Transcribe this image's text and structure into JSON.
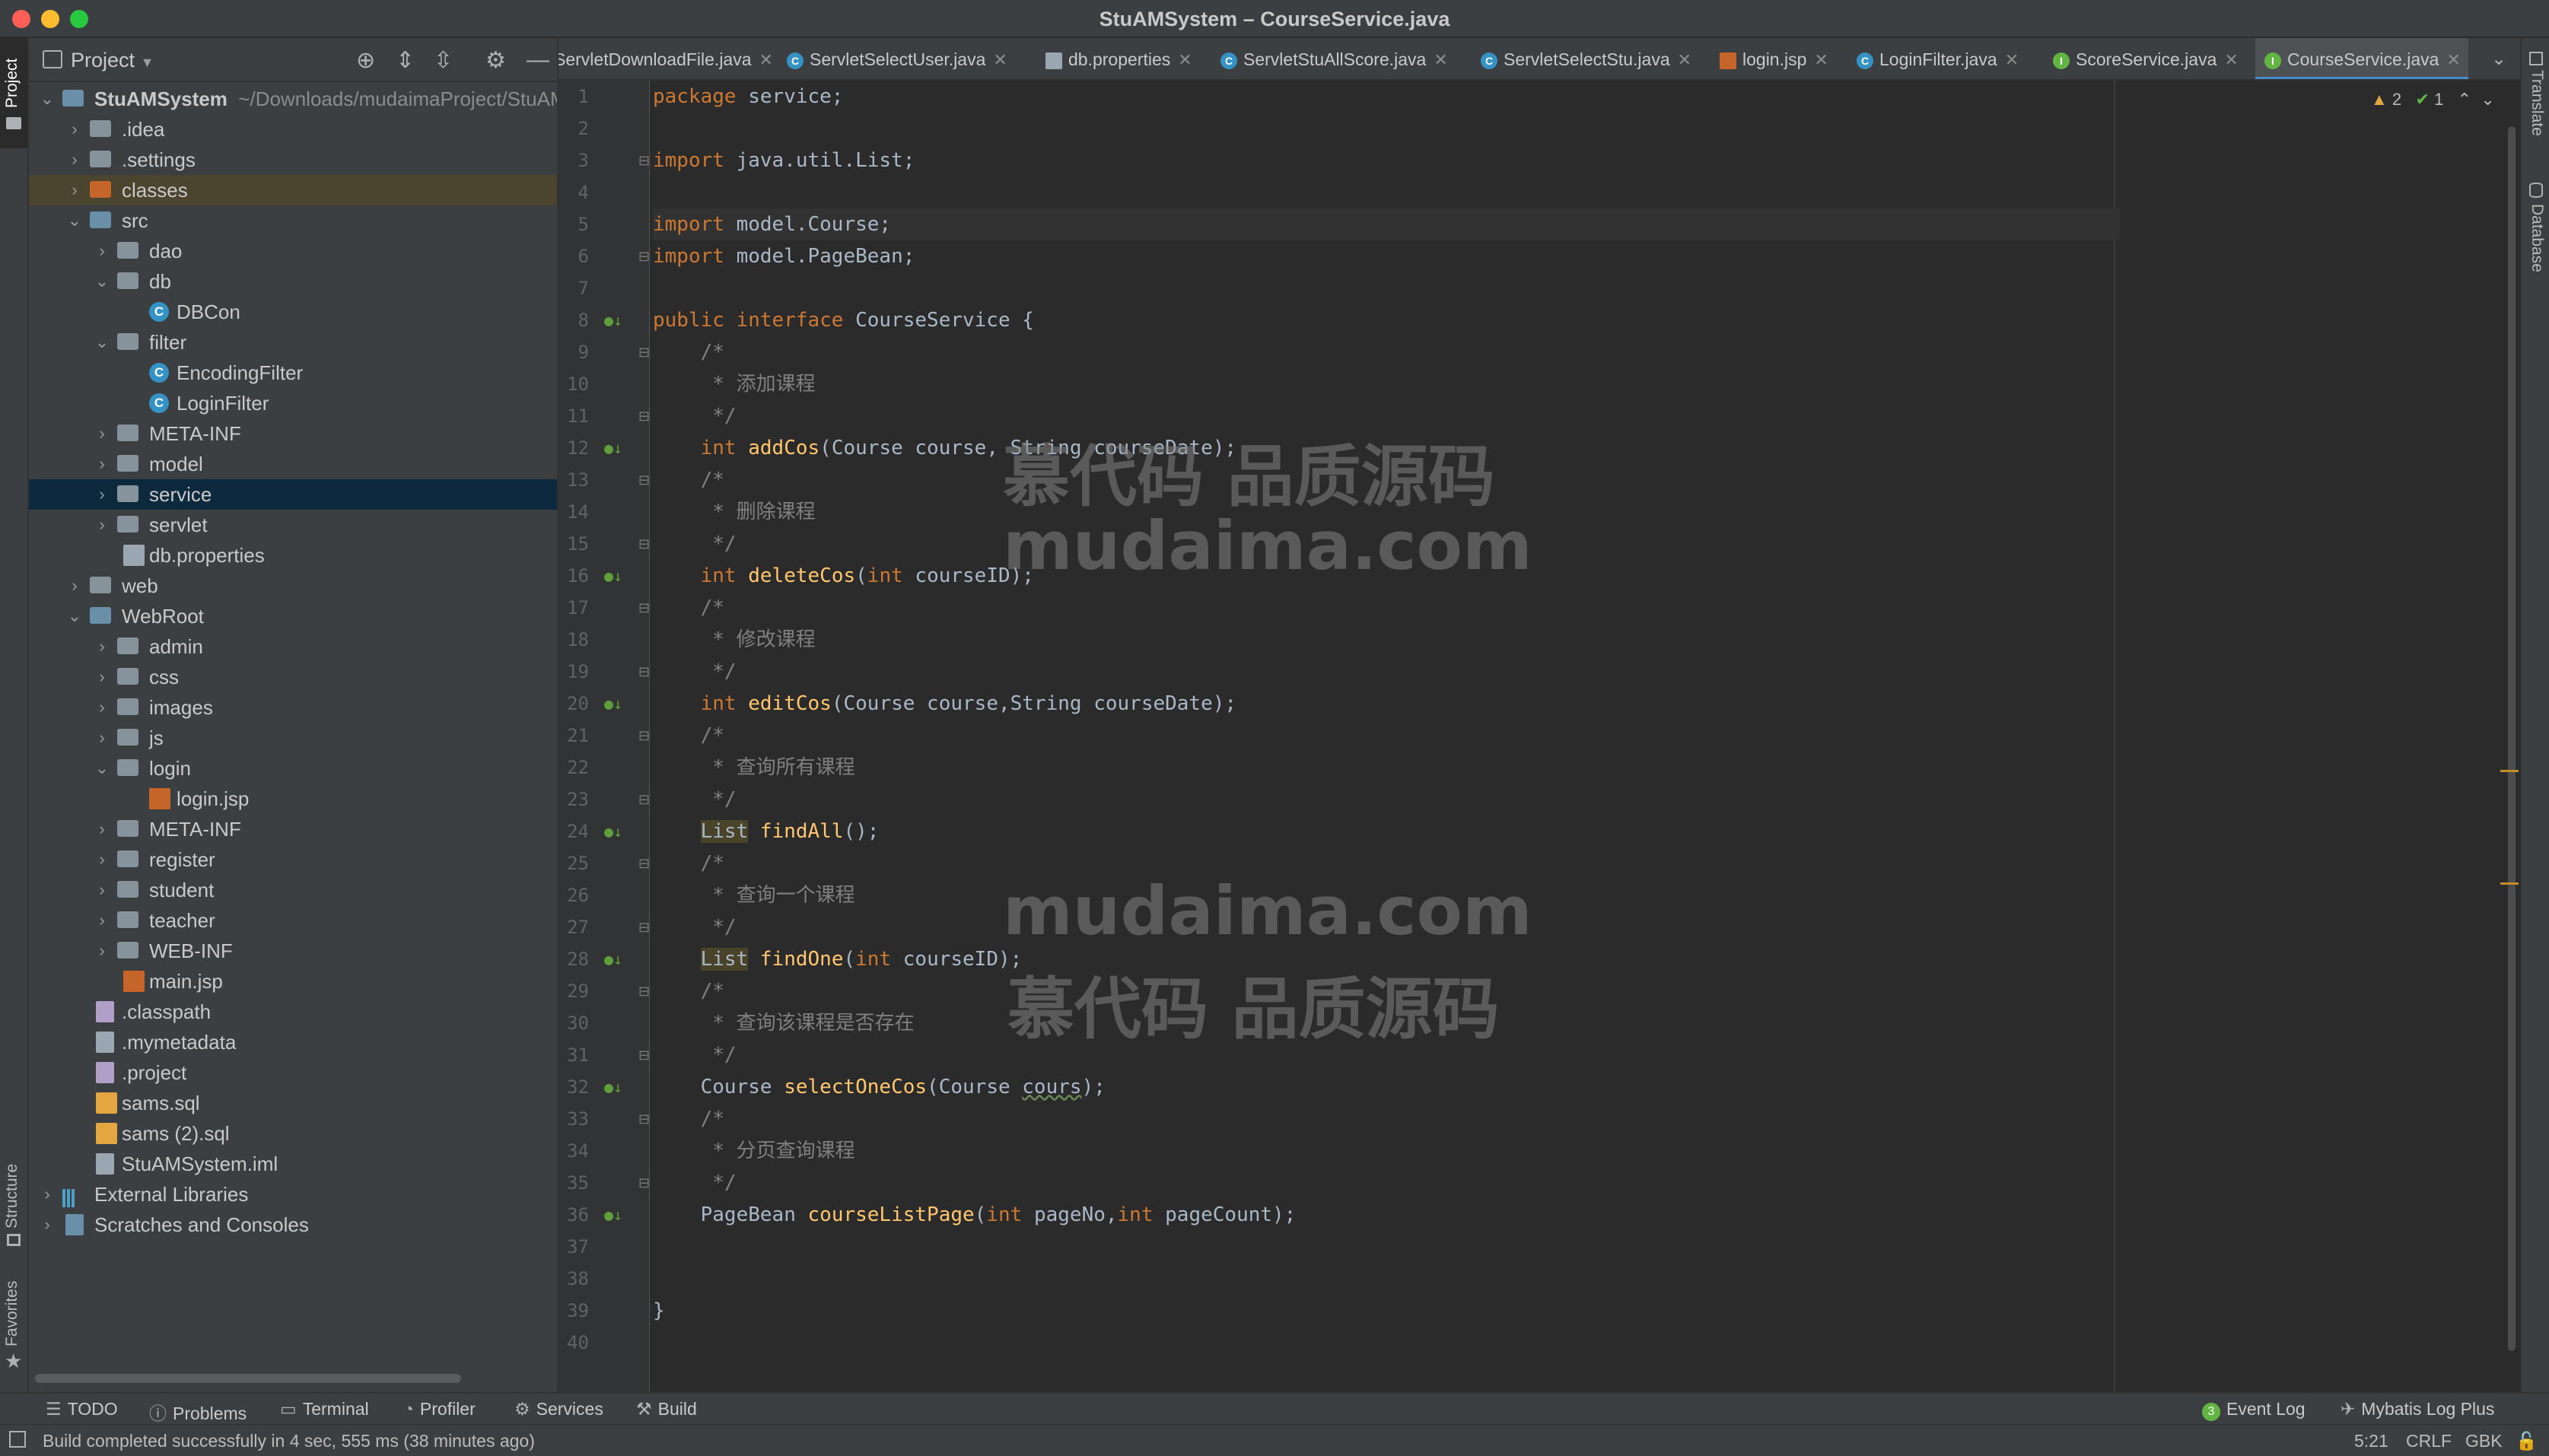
{
  "window": {
    "title": "StuAMSystem – CourseService.java"
  },
  "left_strip": {
    "project_tab": "Project",
    "structure_tab": "Structure",
    "favorites_tab": "Favorites"
  },
  "right_strip": {
    "translate_tab": "Translate",
    "database_tab": "Database"
  },
  "project": {
    "header": "Project",
    "root_name": "StuAMSystem",
    "root_path": "~/Downloads/mudaimaProject/StuAMSystem",
    "items": [
      {
        "label": ".idea"
      },
      {
        "label": ".settings"
      },
      {
        "label": "classes"
      },
      {
        "label": "src"
      },
      {
        "label": "dao"
      },
      {
        "label": "db"
      },
      {
        "label": "DBCon"
      },
      {
        "label": "filter"
      },
      {
        "label": "EncodingFilter"
      },
      {
        "label": "LoginFilter"
      },
      {
        "label": "META-INF"
      },
      {
        "label": "model"
      },
      {
        "label": "service"
      },
      {
        "label": "servlet"
      },
      {
        "label": "db.properties"
      },
      {
        "label": "web"
      },
      {
        "label": "WebRoot"
      },
      {
        "label": "admin"
      },
      {
        "label": "css"
      },
      {
        "label": "images"
      },
      {
        "label": "js"
      },
      {
        "label": "login"
      },
      {
        "label": "login.jsp"
      },
      {
        "label": "META-INF"
      },
      {
        "label": "register"
      },
      {
        "label": "student"
      },
      {
        "label": "teacher"
      },
      {
        "label": "WEB-INF"
      },
      {
        "label": "main.jsp"
      },
      {
        "label": ".classpath"
      },
      {
        "label": ".mymetadata"
      },
      {
        "label": ".project"
      },
      {
        "label": "sams.sql"
      },
      {
        "label": "sams (2).sql"
      },
      {
        "label": "StuAMSystem.iml"
      },
      {
        "label": "External Libraries"
      },
      {
        "label": "Scratches and Consoles"
      }
    ]
  },
  "tabs": [
    {
      "label": "ServletDownloadFile.java"
    },
    {
      "label": "ServletSelectUser.java"
    },
    {
      "label": "db.properties"
    },
    {
      "label": "ServletStuAllScore.java"
    },
    {
      "label": "ServletSelectStu.java"
    },
    {
      "label": "login.jsp"
    },
    {
      "label": "LoginFilter.java"
    },
    {
      "label": "ScoreService.java"
    },
    {
      "label": "CourseService.java"
    }
  ],
  "inspections": {
    "warnings": "2",
    "ok": "1"
  },
  "code": {
    "line_numbers": [
      "1",
      "2",
      "3",
      "4",
      "5",
      "6",
      "7",
      "8",
      "9",
      "10",
      "11",
      "12",
      "13",
      "14",
      "15",
      "16",
      "17",
      "18",
      "19",
      "20",
      "21",
      "22",
      "23",
      "24",
      "25",
      "26",
      "27",
      "28",
      "29",
      "30",
      "31",
      "32",
      "33",
      "34",
      "35",
      "36",
      "37",
      "38",
      "39",
      "40"
    ],
    "l1_kw": "package",
    "l1_rest": " service;",
    "l3_kw": "import",
    "l3_rest": " java.util.List;",
    "l5_kw": "import",
    "l5_rest": " model.Course;",
    "l6_kw": "import",
    "l6_rest": " model.PageBean;",
    "l8_kw1": "public",
    "l8_kw2": "interface",
    "l8_rest": " CourseService {",
    "c_open": "    /*",
    "c_close": "     */",
    "c10": "     * 添加课程",
    "c14": "     * 删除课程",
    "c18": "     * 修改课程",
    "c22": "     * 查询所有课程",
    "c26": "     * 查询一个课程",
    "c30": "     * 查询该课程是否存在",
    "c34": "     * 分页查询课程",
    "l12_kw": "int",
    "l12_fn": "addCos",
    "l12_rest": "(Course course, String courseDate);",
    "l16_kw": "int",
    "l16_fn": "deleteCos",
    "l16_a": "(",
    "l16_kw2": "int",
    "l16_rest": " courseID);",
    "l20_kw": "int",
    "l20_fn": "editCos",
    "l20_rest": "(Course course,String courseDate);",
    "l24_type": "List",
    "l24_fn": "findAll",
    "l24_rest": "();",
    "l28_type": "List",
    "l28_fn": "findOne",
    "l28_a": "(",
    "l28_kw2": "int",
    "l28_rest": " courseID);",
    "l32_type": "Course",
    "l32_fn": "selectOneCos",
    "l32_a": "(Course ",
    "l32_warn": "cours",
    "l32_rest": ");",
    "l36_type": "PageBean",
    "l36_fn": "courseListPage",
    "l36_a": "(",
    "l36_kw2": "int",
    "l36_b": " pageNo,",
    "l36_kw3": "int",
    "l36_rest": " pageCount);",
    "l39": "}"
  },
  "watermark": {
    "line1": "慕代码 品质源码",
    "line2": "mudaima.com",
    "line3": "mudaima.com",
    "line4": "慕代码 品质源码"
  },
  "bottom_tools": {
    "todo": "TODO",
    "problems": "Problems",
    "terminal": "Terminal",
    "profiler": "Profiler",
    "services": "Services",
    "build": "Build",
    "event_log_count": "3",
    "event_log": "Event Log",
    "mybatis": "Mybatis Log Plus"
  },
  "status": {
    "message": "Build completed successfully in 4 sec, 555 ms (38 minutes ago)",
    "position": "5:21",
    "line_sep": "CRLF",
    "encoding": "GBK"
  },
  "colors": {
    "accent": "#4a88c7",
    "keyword": "#cc7832",
    "function": "#ffc66d",
    "comment": "#808080"
  }
}
